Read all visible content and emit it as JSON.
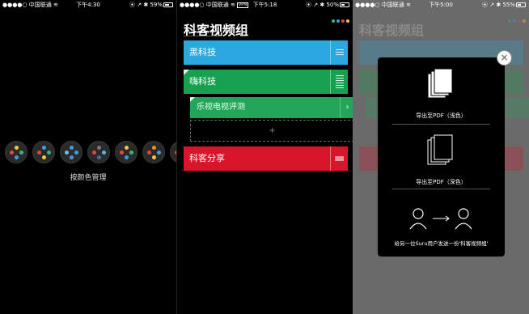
{
  "screens": [
    {
      "status": {
        "carrier": "中国联通",
        "time": "下午4:30",
        "battery": "59%",
        "battery_level": 0.59
      },
      "palettes": [
        {
          "icon": "palette-1-icon",
          "colors": [
            "#f4c542",
            "#e8453c",
            "#3fb27f",
            "#3b9fe0"
          ]
        },
        {
          "icon": "palette-2-icon",
          "colors": [
            "#3b9fe0",
            "#e8453c",
            "#3fb27f",
            "#f4c542"
          ]
        },
        {
          "icon": "palette-3-icon",
          "colors": [
            "#3b9fe0",
            "#7fb2e5",
            "#3b9fe0",
            "#5a8fd0"
          ]
        },
        {
          "icon": "palette-4-icon",
          "colors": [
            "#7a7a7a",
            "#e8453c",
            "#5fb2e5",
            "#3f6fa0"
          ]
        },
        {
          "icon": "palette-5-icon",
          "colors": [
            "#f4c542",
            "#e8453c",
            "#3fb27f",
            "#3b9fe0"
          ]
        },
        {
          "icon": "palette-6-icon",
          "colors": [
            "#f08a24",
            "#e8453c",
            "#3b9fe0",
            "#f4c542"
          ]
        },
        {
          "icon": "palette-7-icon",
          "colors": [
            "#f4c542",
            "#e8453c",
            "#3fb27f",
            "#3b9fe0"
          ]
        }
      ],
      "manage_label": "按颜色管理"
    },
    {
      "status": {
        "carrier": "中国联通",
        "vpn": "VPN",
        "time": "下午5:18",
        "battery": "50%",
        "battery_level": 0.5
      },
      "title": "科客视频组",
      "accent_dots": [
        "#3fb27f",
        "#3b9fe0",
        "#e8453c",
        "#f4c542"
      ],
      "cards": [
        {
          "label": "黑科技",
          "color": "#2ba8e0"
        },
        {
          "label": "嗨科技",
          "color": "#17a04f"
        },
        {
          "label": "科客分享",
          "color": "#d8152b"
        }
      ],
      "sub_item": {
        "label": "乐视电视评测",
        "chevron": "›"
      },
      "add_symbol": "+"
    },
    {
      "status": {
        "carrier": "中国联通",
        "time": "下午5:00",
        "battery": "55%",
        "battery_level": 0.55
      },
      "title": "科客视频组",
      "close_symbol": "×",
      "options": [
        {
          "icon": "light-pdf-icon",
          "label": "导出至PDF（浅色）"
        },
        {
          "icon": "dark-pdf-icon",
          "label": "导出至PDF（深色）"
        },
        {
          "icon": "share-user-icon",
          "label": "给另一位Suru用户发送一份'科客视频组'"
        }
      ]
    }
  ]
}
